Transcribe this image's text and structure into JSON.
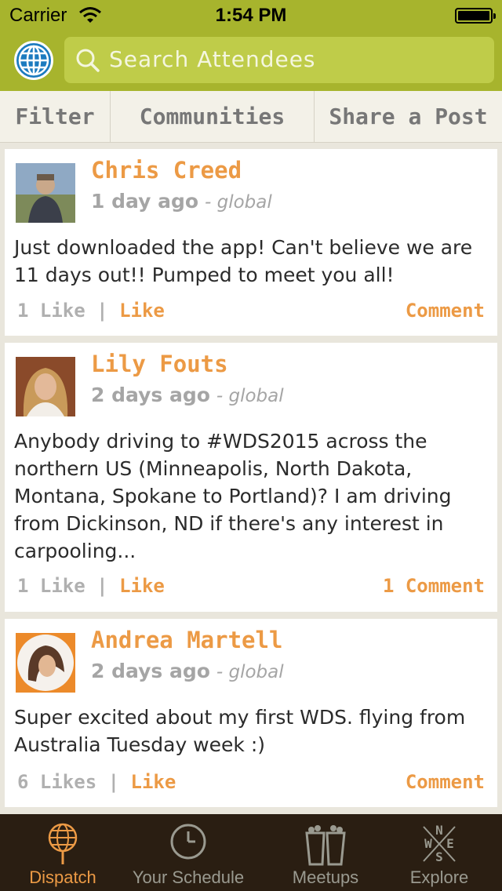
{
  "status_bar": {
    "carrier": "Carrier",
    "time": "1:54 PM"
  },
  "header": {
    "search_placeholder": "Search Attendees"
  },
  "segments": {
    "filter": "Filter",
    "communities": "Communities",
    "share": "Share a Post"
  },
  "posts": [
    {
      "author": "Chris Creed",
      "time_ago": "1 day ago",
      "scope": "- global",
      "body": "Just downloaded the app! Can't believe we are 11 days out!! Pumped to meet you all!",
      "likes": "1 Like",
      "like_label": "Like",
      "comment_label": "Comment"
    },
    {
      "author": "Lily Fouts",
      "time_ago": "2 days ago",
      "scope": "- global",
      "body": "Anybody driving to #WDS2015 across the northern US (Minneapolis, North Dakota, Montana, Spokane to Portland)?  I am driving from Dickinson, ND if there's any interest in carpooling...",
      "likes": "1 Like",
      "like_label": "Like",
      "comment_label": "1 Comment"
    },
    {
      "author": "Andrea Martell",
      "time_ago": "2 days ago",
      "scope": "- global",
      "body": "Super excited about my first WDS. flying from Australia Tuesday week :)",
      "likes": "6 Likes",
      "like_label": "Like",
      "comment_label": "Comment"
    }
  ],
  "tabs": [
    {
      "label": "Dispatch",
      "icon": "dispatch-globe-icon",
      "active": true
    },
    {
      "label": "Your Schedule",
      "icon": "clock-icon",
      "active": false
    },
    {
      "label": "Meetups",
      "icon": "beer-glasses-icon",
      "active": false
    },
    {
      "label": "Explore",
      "icon": "compass-icon",
      "active": false
    }
  ],
  "colors": {
    "header": "#a7b42d",
    "accent": "#ec9a45",
    "tabbar": "#2a1e12"
  }
}
